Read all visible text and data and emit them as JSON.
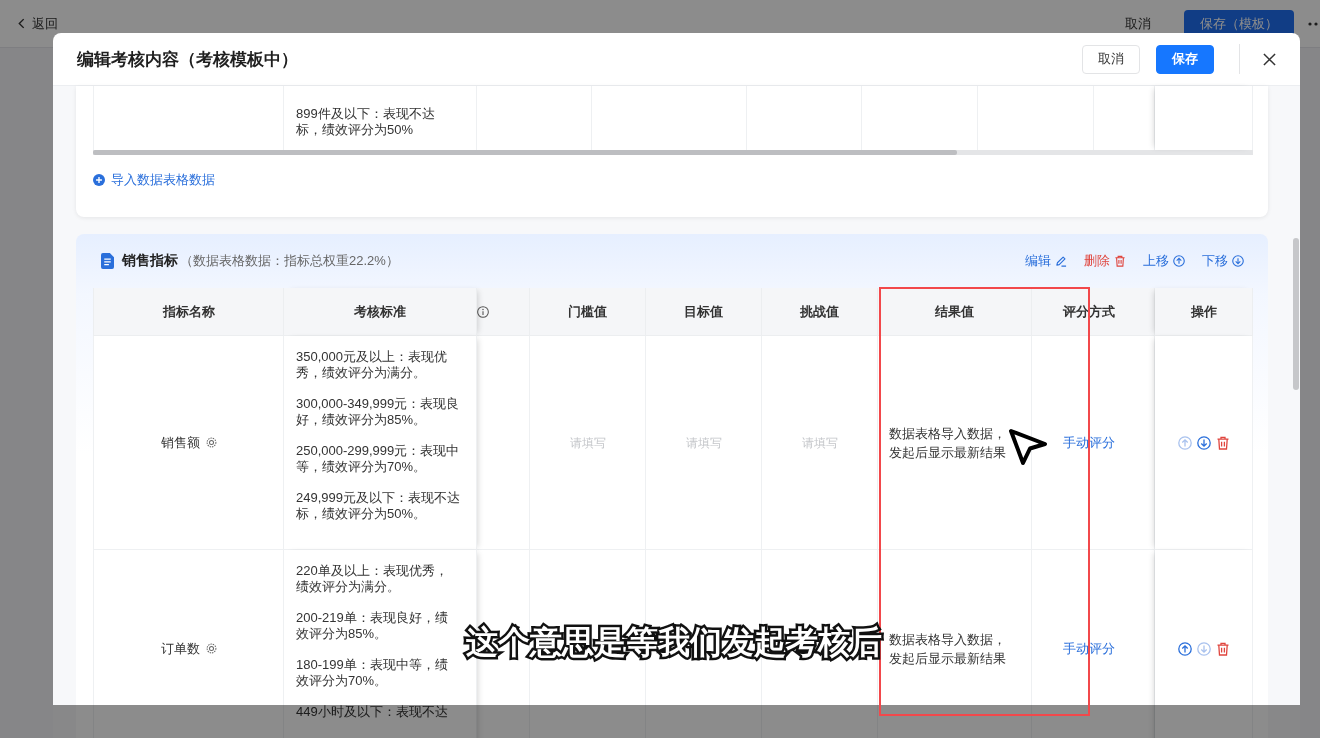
{
  "page": {
    "back": "返回",
    "buttons": [
      {
        "label": "取消",
        "kind": "text"
      },
      {
        "label": "保存（模板）",
        "kind": "primary"
      }
    ]
  },
  "dialog": {
    "title": "编辑考核内容（考核模板中）",
    "buttons": [
      {
        "label": "取消",
        "kind": "plain"
      },
      {
        "label": "保存",
        "kind": "primary"
      }
    ]
  },
  "previous_section": {
    "rows": [
      {
        "criteria": [
          "899件及以下：表现不达标，绩效评分为50%"
        ]
      }
    ],
    "import_link": "导入数据表格数据"
  },
  "section": {
    "title": "销售指标",
    "subtitle": "（数据表格数据：指标总权重22.2%）",
    "actions": [
      {
        "label": "编辑",
        "kind": "edit"
      },
      {
        "label": "删除",
        "kind": "delete"
      },
      {
        "label": "上移",
        "kind": "up"
      },
      {
        "label": "下移",
        "kind": "down"
      }
    ],
    "table": {
      "columns": [
        {
          "kind": "text",
          "label": "指标名称"
        },
        {
          "kind": "text",
          "label": "考核标准"
        },
        {
          "kind": "info"
        },
        {
          "kind": "text",
          "label": "门槛值"
        },
        {
          "kind": "text",
          "label": "目标值"
        },
        {
          "kind": "text",
          "label": "挑战值"
        },
        {
          "kind": "text",
          "label": "结果值"
        },
        {
          "kind": "text",
          "label": "评分方式"
        },
        {
          "kind": "text",
          "label": "操作"
        }
      ],
      "rows": [
        {
          "name": "销售额",
          "criteria": [
            "350,000元及以上：表现优秀，绩效评分为满分。",
            "300,000-349,999元：表现良好，绩效评分为85%。",
            "250,000-299,999元：表现中等，绩效评分为70%。",
            "249,999元及以下：表现不达标，绩效评分为50%。"
          ],
          "fields": [
            {
              "placeholder": "请填写"
            },
            {
              "placeholder": "请填写"
            },
            {
              "placeholder": "请填写"
            }
          ],
          "result": "数据表格导入数据，发起后显示最新结果",
          "scoring": "手动评分",
          "ops": [
            {
              "kind": "up",
              "disabled": true
            },
            {
              "kind": "down",
              "disabled": false
            },
            {
              "kind": "delete",
              "disabled": false
            }
          ]
        },
        {
          "name": "订单数",
          "criteria": [
            "220单及以上：表现优秀，绩效评分为满分。",
            "200-219单：表现良好，绩效评分为85%。",
            "180-199单：表现中等，绩效评分为70%。",
            "449小时及以下：表现不达"
          ],
          "result": "数据表格导入数据，发起后显示最新结果",
          "scoring": "手动评分",
          "ops": [
            {
              "kind": "up",
              "disabled": false
            },
            {
              "kind": "down",
              "disabled": true
            },
            {
              "kind": "delete",
              "disabled": false
            }
          ]
        }
      ]
    }
  },
  "annotations": [
    {
      "kind": "frame"
    },
    {
      "kind": "pointer"
    }
  ],
  "caption": "这个意思是等我们发起考核后"
}
